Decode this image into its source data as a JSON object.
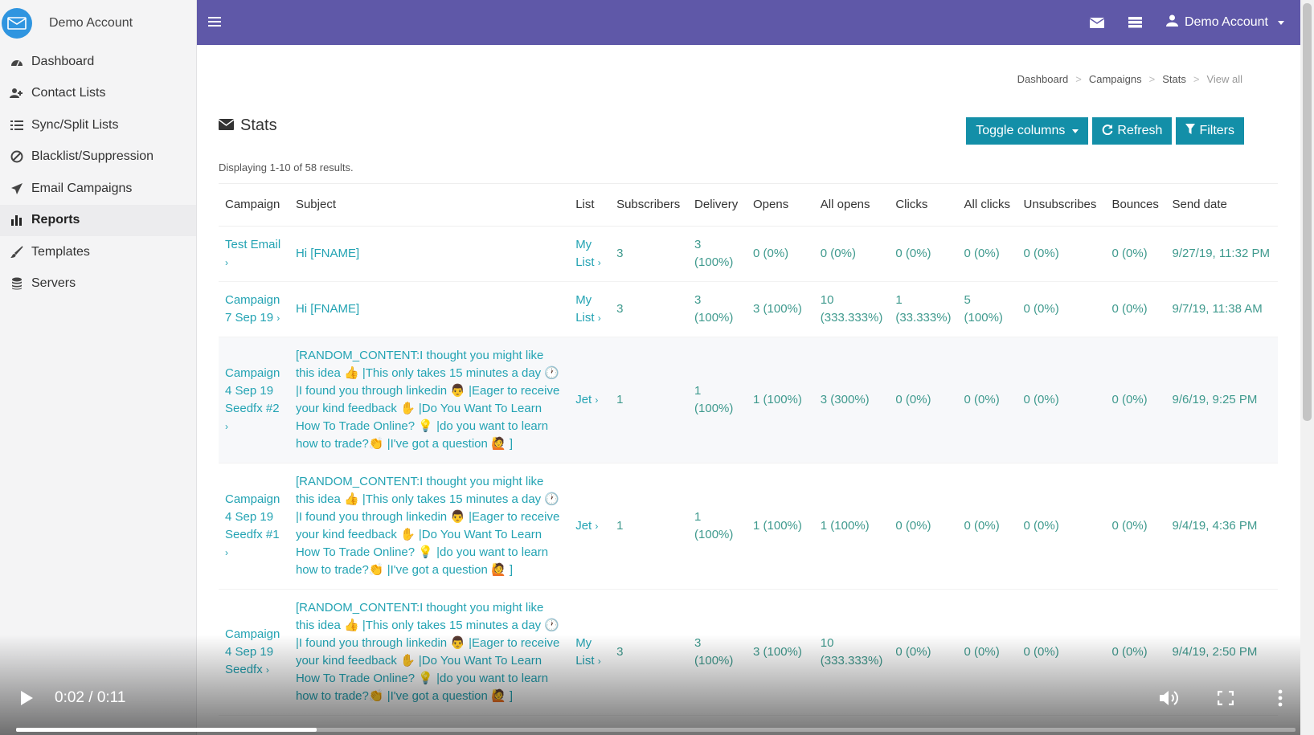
{
  "colors": {
    "topbar": "#5f58a8",
    "button": "#138fa8",
    "link": "#23a3b3",
    "cell_text": "#3f9a8e",
    "sidebar_bg": "#f4f4f5"
  },
  "sidebar": {
    "account_name": "Demo Account",
    "items": [
      {
        "label": "Dashboard",
        "icon": "dashboard-icon"
      },
      {
        "label": "Contact Lists",
        "icon": "users-icon"
      },
      {
        "label": "Sync/Split Lists",
        "icon": "list-icon"
      },
      {
        "label": "Blacklist/Suppression",
        "icon": "ban-icon"
      },
      {
        "label": "Email Campaigns",
        "icon": "paper-plane-icon"
      },
      {
        "label": "Reports",
        "icon": "bar-chart-icon",
        "active": true
      },
      {
        "label": "Templates",
        "icon": "brush-icon"
      },
      {
        "label": "Servers",
        "icon": "database-icon"
      }
    ]
  },
  "topbar": {
    "account_label": "Demo Account"
  },
  "breadcrumb": {
    "items": [
      "Dashboard",
      "Campaigns",
      "Stats"
    ],
    "current": "View all",
    "separator": ">"
  },
  "page": {
    "title": "Stats",
    "summary": "Displaying 1-10 of 58 results.",
    "buttons": {
      "toggle_columns": "Toggle columns",
      "refresh": "Refresh",
      "filters": "Filters"
    }
  },
  "table": {
    "headers": [
      "Campaign",
      "Subject",
      "List",
      "Subscribers",
      "Delivery",
      "Opens",
      "All opens",
      "Clicks",
      "All clicks",
      "Unsubscribes",
      "Bounces",
      "Send date"
    ],
    "rows": [
      {
        "campaign": "Test Email",
        "subject": "Hi [FNAME]",
        "list": "My List",
        "subscribers": "3",
        "delivery": "3 (100%)",
        "opens": "0 (0%)",
        "all_opens": "0 (0%)",
        "clicks": "0 (0%)",
        "all_clicks": "0 (0%)",
        "unsubscribes": "0 (0%)",
        "bounces": "0 (0%)",
        "send_date": "9/27/19, 11:32 PM"
      },
      {
        "campaign": "Campaign 7 Sep 19",
        "subject": "Hi [FNAME]",
        "list": "My List",
        "subscribers": "3",
        "delivery": "3 (100%)",
        "opens": "3 (100%)",
        "all_opens": "10 (333.333%)",
        "clicks": "1 (33.333%)",
        "all_clicks": "5 (100%)",
        "unsubscribes": "0 (0%)",
        "bounces": "0 (0%)",
        "send_date": "9/7/19, 11:38 AM"
      },
      {
        "campaign": "Campaign 4 Sep 19 Seedfx #2",
        "subject": "[RANDOM_CONTENT:I thought you might like this idea 👍 |This only takes 15 minutes a day 🕐 |I found you through linkedin 👨 |Eager to receive your kind feedback ✋ |Do You Want To Learn How To Trade Online? 💡 |do you want to learn how to trade?👏 |I've got a question 🙋 ]",
        "list": "Jet",
        "subscribers": "1",
        "delivery": "1 (100%)",
        "opens": "1 (100%)",
        "all_opens": "3 (300%)",
        "clicks": "0 (0%)",
        "all_clicks": "0 (0%)",
        "unsubscribes": "0 (0%)",
        "bounces": "0 (0%)",
        "send_date": "9/6/19, 9:25 PM"
      },
      {
        "campaign": "Campaign 4 Sep 19 Seedfx #1",
        "subject": "[RANDOM_CONTENT:I thought you might like this idea 👍 |This only takes 15 minutes a day 🕐 |I found you through linkedin 👨 |Eager to receive your kind feedback ✋ |Do You Want To Learn How To Trade Online? 💡 |do you want to learn how to trade?👏 |I've got a question 🙋 ]",
        "list": "Jet",
        "subscribers": "1",
        "delivery": "1 (100%)",
        "opens": "1 (100%)",
        "all_opens": "1 (100%)",
        "clicks": "0 (0%)",
        "all_clicks": "0 (0%)",
        "unsubscribes": "0 (0%)",
        "bounces": "0 (0%)",
        "send_date": "9/4/19, 4:36 PM"
      },
      {
        "campaign": "Campaign 4 Sep 19 Seedfx",
        "subject": "[RANDOM_CONTENT:I thought you might like this idea 👍 |This only takes 15 minutes a day 🕐 |I found you through linkedin 👨 |Eager to receive your kind feedback ✋ |Do You Want To Learn How To Trade Online? 💡 |do you want to learn how to trade?👏 |I've got a question 🙋 ]",
        "list": "My List",
        "subscribers": "3",
        "delivery": "3 (100%)",
        "opens": "3 (100%)",
        "all_opens": "10 (333.333%)",
        "clicks": "0 (0%)",
        "all_clicks": "0 (0%)",
        "unsubscribes": "0 (0%)",
        "bounces": "0 (0%)",
        "send_date": "9/4/19, 2:50 PM"
      }
    ]
  },
  "video": {
    "time": "0:02 / 0:11",
    "progress": 0.235
  }
}
